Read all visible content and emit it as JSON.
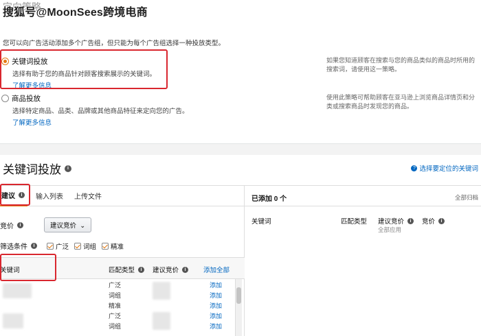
{
  "watermark": "搜狐号@MoonSees跨境电商",
  "top": {
    "title": "定向策略",
    "description": "您可以向广告活动添加多个广告组，但只能为每个广告组选择一种投放类型。",
    "options": [
      {
        "label": "关键词投放",
        "sub": "选择有助于您的商品针对顾客搜索展示的关键词。",
        "link": "了解更多信息",
        "note": "如果您知道顾客在搜索与您的商品类似的商品时所用的搜索词，请使用这一策略。",
        "checked": true
      },
      {
        "label": "商品投放",
        "sub": "选择特定商品、品类、品牌或其他商品特征来定向您的广告。",
        "link": "了解更多信息",
        "note": "使用此策略可帮助顾客在亚马逊上浏览商品详情页和分类或搜索商品时发现您的商品。",
        "checked": false
      }
    ]
  },
  "keyword_section": {
    "title": "关键词投放",
    "help_link": "选择要定位的关键词"
  },
  "left_panel": {
    "tabs": [
      {
        "label": "建议",
        "active": true
      },
      {
        "label": "输入列表",
        "active": false
      },
      {
        "label": "上传文件",
        "active": false
      }
    ],
    "bid_label": "竞价",
    "bid_select": "建议竞价",
    "filter_label": "筛选条件",
    "filters": [
      "广泛",
      "词组",
      "精准"
    ],
    "columns": {
      "keyword": "关键词",
      "match": "匹配类型",
      "suggested": "建议竞价",
      "add_all": "添加全部"
    },
    "rows": [
      {
        "match": "广泛",
        "action": "添加"
      },
      {
        "match": "词组",
        "action": "添加"
      },
      {
        "match": "精准",
        "action": "添加"
      },
      {
        "match": "广泛",
        "action": "添加"
      },
      {
        "match": "词组",
        "action": "添加"
      }
    ]
  },
  "right_panel": {
    "title": "已添加 0 个",
    "archive": "全部归档",
    "columns": {
      "keyword": "关键词",
      "match": "匹配类型",
      "suggested": "建议竞价",
      "bid": "竞价"
    },
    "apply_all": "全部应用"
  },
  "colors": {
    "accent": "#e47911",
    "link": "#0066c0",
    "highlight": "#d9262e"
  }
}
